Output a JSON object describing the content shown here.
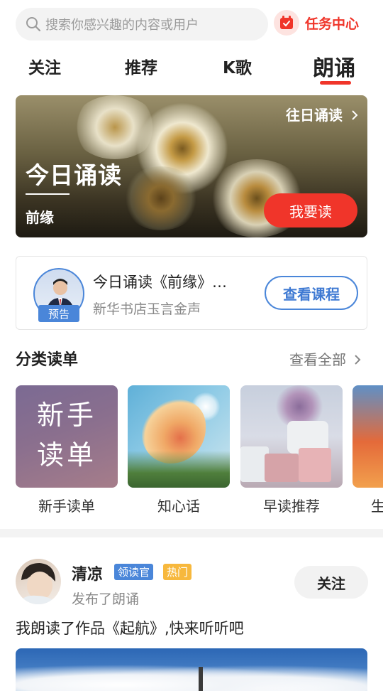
{
  "search": {
    "placeholder": "搜索你感兴趣的内容或用户"
  },
  "task_center": {
    "label": "任务中心"
  },
  "tabs": [
    {
      "label": "关注"
    },
    {
      "label": "推荐"
    },
    {
      "label": "K歌"
    },
    {
      "label": "朗诵",
      "active": true
    }
  ],
  "banner": {
    "past_link": "往日诵读",
    "title": "今日诵读",
    "subtitle": "前缘",
    "action": "我要读"
  },
  "preview": {
    "badge": "预告",
    "title": "今日诵读《前缘》…",
    "subtitle": "新华书店玉言金声",
    "action": "查看课程"
  },
  "category": {
    "title": "分类读单",
    "more": "查看全部",
    "items": [
      {
        "label": "新手读单",
        "cover_text": [
          "新手",
          "读单"
        ]
      },
      {
        "label": "知心话"
      },
      {
        "label": "早读推荐"
      },
      {
        "label": "生"
      }
    ]
  },
  "post": {
    "user": "清凉",
    "tags": [
      "领读官",
      "热门"
    ],
    "meta": "发布了朗诵",
    "follow": "关注",
    "text": "我朗读了作品《起航》,快来听听吧"
  },
  "colors": {
    "accent": "#f0352a",
    "blue": "#4a86d9",
    "tag_yellow": "#f7b83d"
  },
  "icons": [
    "search-icon",
    "calendar-icon",
    "chevron-right-icon"
  ]
}
